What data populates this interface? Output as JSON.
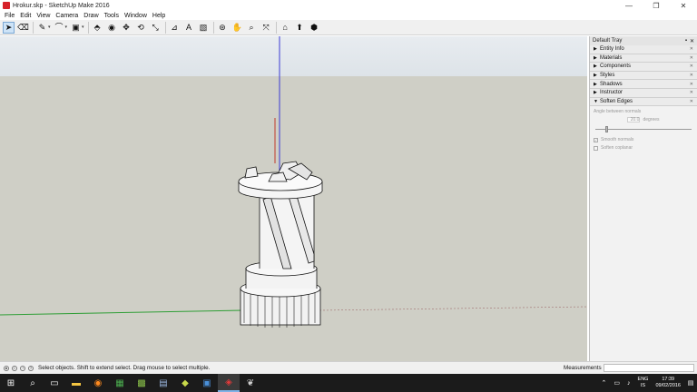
{
  "window": {
    "title": "Hrokur.skp - SketchUp Make 2016",
    "minimize": "—",
    "restore": "❐",
    "close": "✕"
  },
  "menu": [
    "File",
    "Edit",
    "View",
    "Camera",
    "Draw",
    "Tools",
    "Window",
    "Help"
  ],
  "toolbar": {
    "tools": [
      {
        "name": "select-tool",
        "glyph": "➤",
        "selected": true
      },
      {
        "name": "eraser-tool",
        "glyph": "⌫"
      },
      {
        "name": "line-tool",
        "glyph": "✎",
        "dropdown": true
      },
      {
        "name": "arc-tool",
        "glyph": "⌒",
        "dropdown": true
      },
      {
        "name": "shape-tool",
        "glyph": "▣",
        "dropdown": true
      },
      {
        "name": "push-pull-tool",
        "glyph": "⬘"
      },
      {
        "name": "offset-tool",
        "glyph": "◉"
      },
      {
        "name": "move-tool",
        "glyph": "✥"
      },
      {
        "name": "rotate-tool",
        "glyph": "⟲"
      },
      {
        "name": "scale-tool",
        "glyph": "⤡"
      },
      {
        "name": "tape-measure-tool",
        "glyph": "⊿"
      },
      {
        "name": "text-tool",
        "glyph": "A"
      },
      {
        "name": "paint-bucket-tool",
        "glyph": "▧"
      },
      {
        "name": "orbit-tool",
        "glyph": "⊛"
      },
      {
        "name": "pan-tool",
        "glyph": "✋"
      },
      {
        "name": "zoom-tool",
        "glyph": "⌕"
      },
      {
        "name": "zoom-extents-tool",
        "glyph": "⤧"
      },
      {
        "name": "warehouse-tool",
        "glyph": "⌂"
      },
      {
        "name": "share-model-tool",
        "glyph": "⬆"
      },
      {
        "name": "extension-warehouse-tool",
        "glyph": "⬢"
      }
    ]
  },
  "tray": {
    "title": "Default Tray",
    "pin": "▪",
    "close": "✕",
    "panels": [
      {
        "label": "Entity Info",
        "expanded": false
      },
      {
        "label": "Materials",
        "expanded": false
      },
      {
        "label": "Components",
        "expanded": false
      },
      {
        "label": "Styles",
        "expanded": false
      },
      {
        "label": "Shadows",
        "expanded": false
      },
      {
        "label": "Instructor",
        "expanded": false
      },
      {
        "label": "Soften Edges",
        "expanded": true
      }
    ],
    "soften_edges": {
      "angle_label": "Angle between normals",
      "angle_value": "20.0",
      "angle_unit": "degrees",
      "slider_fraction": 0.1,
      "smooth_normals": "Smooth normals",
      "smooth_checked": true,
      "soften_coplanar": "Soften coplanar",
      "coplanar_checked": false
    }
  },
  "status": {
    "text": "Select objects. Shift to extend select. Drag mouse to select multiple.",
    "measurements_label": "Measurements",
    "measurements_value": ""
  },
  "taskbar": {
    "language_top": "ENG",
    "language_bottom": "IS",
    "time": "17:39",
    "date": "09/02/2016"
  },
  "colors": {
    "red_axis": "#c0392b",
    "green_axis": "#2e9e35",
    "blue_axis": "#3b3bd4",
    "ground": "#cfcfc6",
    "sky": "#e0e6eb"
  }
}
